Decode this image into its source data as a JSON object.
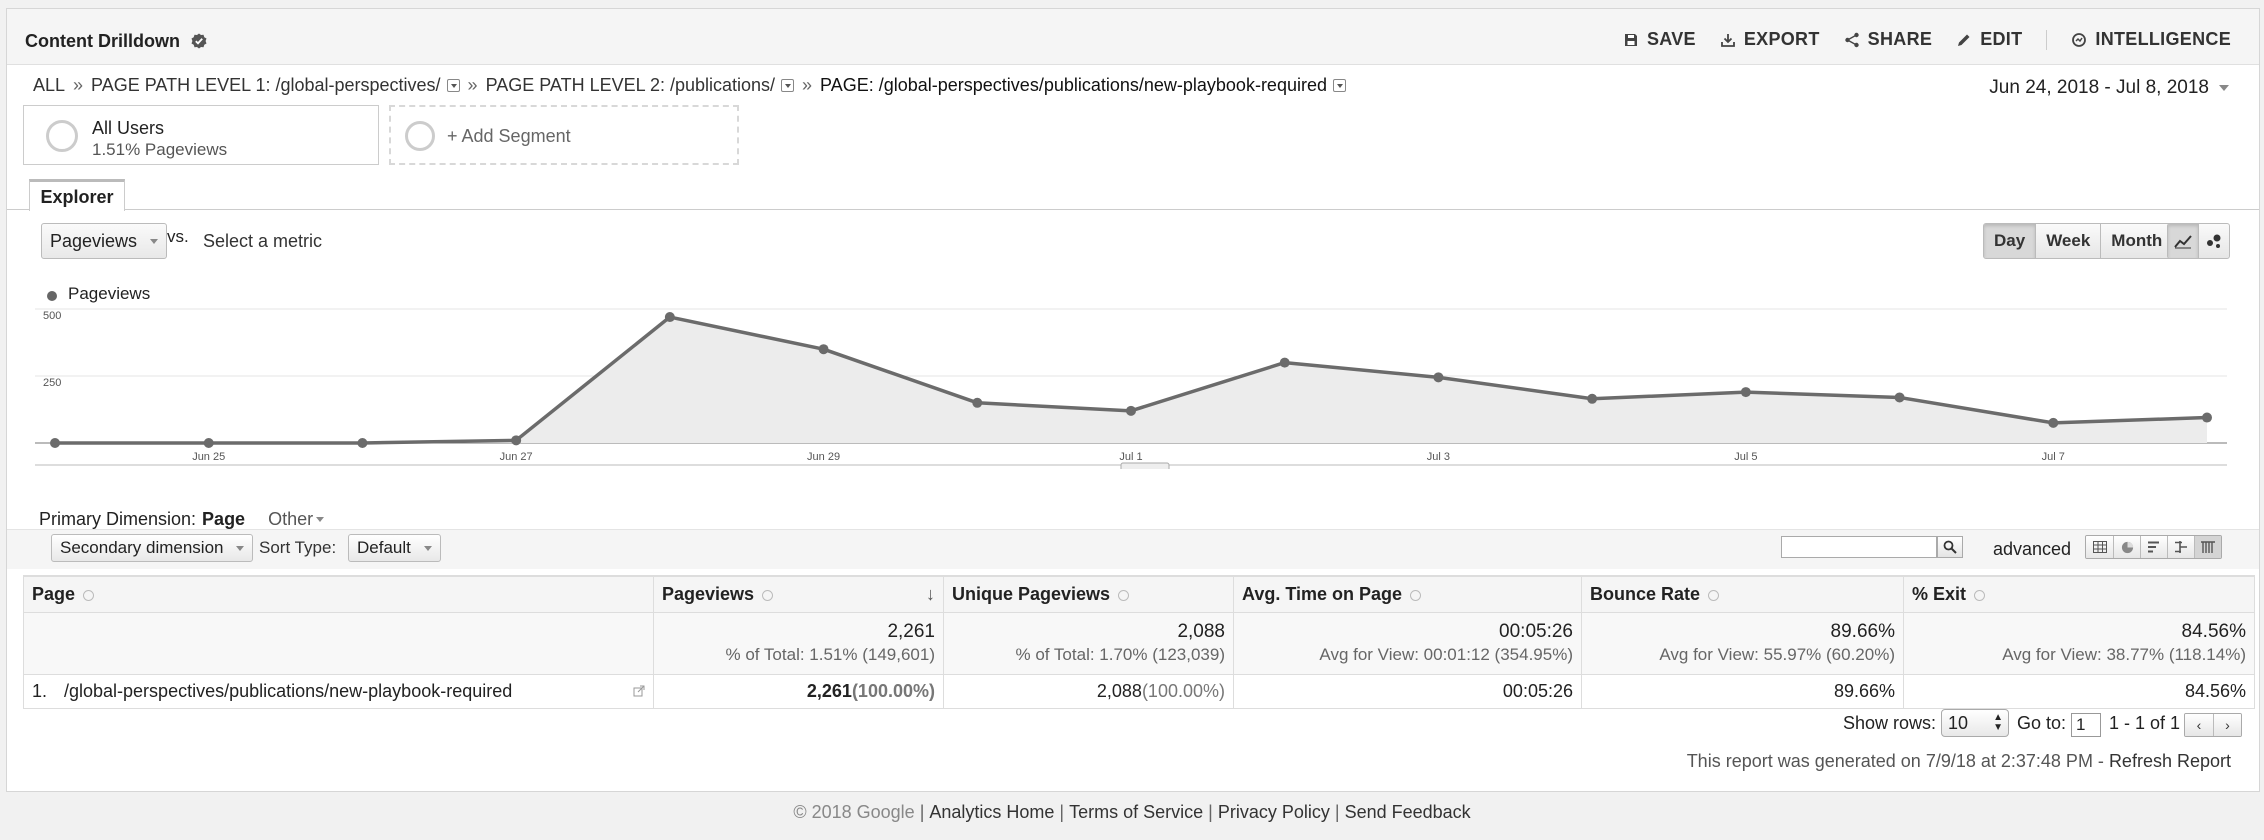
{
  "header": {
    "title": "Content Drilldown",
    "actions": {
      "save": "SAVE",
      "export": "EXPORT",
      "share": "SHARE",
      "edit": "EDIT",
      "intelligence": "INTELLIGENCE"
    }
  },
  "breadcrumb": {
    "all": "ALL",
    "level1": "PAGE PATH LEVEL 1: /global-perspectives/",
    "level2": "PAGE PATH LEVEL 2: /publications/",
    "page": "PAGE: /global-perspectives/publications/new-playbook-required"
  },
  "date_range": "Jun 24, 2018 - Jul 8, 2018",
  "segments": {
    "current": {
      "name": "All Users",
      "sub": "1.51% Pageviews"
    },
    "add_label": "+ Add Segment"
  },
  "explorer": {
    "tab_label": "Explorer",
    "metric": "Pageviews",
    "vs": "vs.",
    "select_metric": "Select a metric",
    "granularity": {
      "day": "Day",
      "week": "Week",
      "month": "Month",
      "active": "day"
    }
  },
  "chart_data": {
    "type": "area",
    "series": [
      {
        "name": "Pageviews",
        "values": [
          0,
          0,
          0,
          10,
          470,
          350,
          150,
          120,
          300,
          245,
          165,
          190,
          170,
          75,
          95
        ]
      }
    ],
    "x": [
      "Jun 24",
      "Jun 25",
      "Jun 26",
      "Jun 27",
      "Jun 28",
      "Jun 29",
      "Jun 30",
      "Jul 1",
      "Jul 2",
      "Jul 3",
      "Jul 4",
      "Jul 5",
      "Jul 6",
      "Jul 7",
      "Jul 8"
    ],
    "x_tick_labels": [
      "Jun 25",
      "Jun 27",
      "Jun 29",
      "Jul 1",
      "Jul 3",
      "Jul 5",
      "Jul 7"
    ],
    "y_ticks": [
      250,
      500
    ],
    "ylim": [
      0,
      500
    ],
    "grid": true,
    "colors": {
      "line": "#6b6b6b",
      "fill": "#ececec"
    }
  },
  "dimension": {
    "label": "Primary Dimension:",
    "current": "Page",
    "other": "Other",
    "secondary": "Secondary dimension",
    "sort_label": "Sort Type:",
    "sort_value": "Default",
    "advanced": "advanced"
  },
  "table": {
    "headers": {
      "page": "Page",
      "pageviews": "Pageviews",
      "unique": "Unique Pageviews",
      "avg_time": "Avg. Time on Page",
      "bounce": "Bounce Rate",
      "exit": "% Exit"
    },
    "totals": {
      "pageviews": "2,261",
      "pageviews_sub": "% of Total: 1.51% (149,601)",
      "unique": "2,088",
      "unique_sub": "% of Total: 1.70% (123,039)",
      "avg_time": "00:05:26",
      "avg_time_sub": "Avg for View: 00:01:12 (354.95%)",
      "bounce": "89.66%",
      "bounce_sub": "Avg for View: 55.97% (60.20%)",
      "exit": "84.56%",
      "exit_sub": "Avg for View: 38.77% (118.14%)"
    },
    "rows": [
      {
        "index": "1.",
        "page": "/global-perspectives/publications/new-playbook-required",
        "pageviews": "2,261",
        "pageviews_pct": "(100.00%)",
        "unique": "2,088",
        "unique_pct": "(100.00%)",
        "avg_time": "00:05:26",
        "bounce": "89.66%",
        "exit": "84.56%"
      }
    ]
  },
  "pagination": {
    "show_rows_label": "Show rows:",
    "show_rows": "10",
    "goto_label": "Go to:",
    "goto": "1",
    "range": "1 - 1 of 1"
  },
  "generated": {
    "text": "This report was generated on 7/9/18 at 2:37:48 PM - ",
    "refresh": "Refresh Report"
  },
  "footer": {
    "copyright": "© 2018 Google",
    "links": [
      "Analytics Home",
      "Terms of Service",
      "Privacy Policy",
      "Send Feedback"
    ]
  }
}
